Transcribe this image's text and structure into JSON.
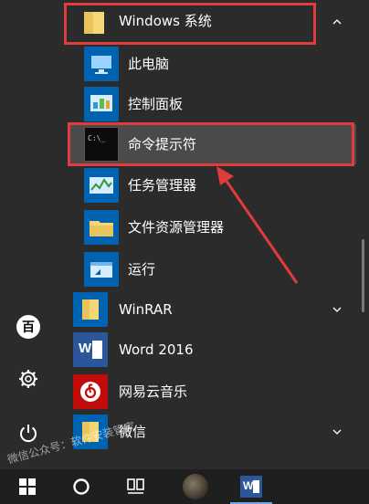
{
  "start_menu": {
    "groups": [
      {
        "label": "Windows 系统",
        "expanded": true
      },
      {
        "label": "WinRAR",
        "expanded": false
      },
      {
        "label": "微信",
        "expanded": false
      }
    ],
    "windows_items": [
      {
        "label": "此电脑",
        "icon": "computer-icon"
      },
      {
        "label": "控制面板",
        "icon": "control-panel-icon"
      },
      {
        "label": "命令提示符",
        "icon": "command-prompt-icon",
        "prompt_glyph": "C:\\_"
      },
      {
        "label": "任务管理器",
        "icon": "task-manager-icon"
      },
      {
        "label": "文件资源管理器",
        "icon": "file-explorer-icon"
      },
      {
        "label": "运行",
        "icon": "run-icon"
      }
    ],
    "apps": [
      {
        "label": "Word 2016",
        "icon": "word-icon",
        "glyph": "W"
      },
      {
        "label": "网易云音乐",
        "icon": "netease-music-icon"
      }
    ]
  },
  "sidebar": {
    "items": [
      "user-avatar-icon",
      "settings-icon",
      "power-icon"
    ],
    "avatar_glyph": "百"
  },
  "taskbar": {
    "word_glyph": "W",
    "items": [
      "start-button",
      "cortana-circle",
      "task-view",
      "app-thumbnail",
      "word-taskbar"
    ]
  },
  "watermark": "微信公众号：软件安装管家",
  "colors": {
    "highlight_red": "#e23b3b",
    "folder": "#f6d776",
    "tile_blue": "#0063b1",
    "background": "#2b2b2b",
    "taskbar": "#1f1f1f"
  }
}
